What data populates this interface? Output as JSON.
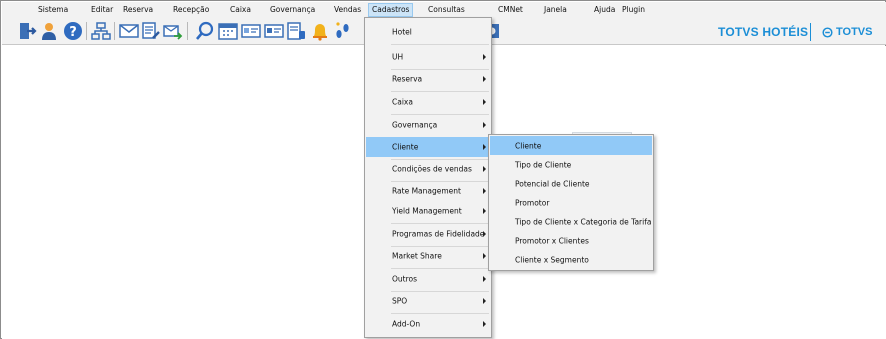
{
  "menubar": {
    "items": [
      "Sistema",
      "Editar",
      "Reserva",
      "Recepção",
      "Caixa",
      "Governança",
      "Vendas",
      "Cadastros",
      "Consultas",
      "CMNet",
      "Janela",
      "Ajuda",
      "Plugin"
    ],
    "active": "Cadastros"
  },
  "toolbar": {
    "icons": [
      "exit-icon",
      "user-icon",
      "help-icon",
      "network-icon",
      "mail-icon",
      "mail-edit-icon",
      "mail-send-icon",
      "search-icon",
      "calendar-icon",
      "card-icon",
      "card-alt-icon",
      "phone-icon",
      "bell-icon",
      "footprints-icon"
    ]
  },
  "brand": {
    "name": "TOTVS HOTÉIS",
    "logo": "TOTVS",
    "color": "#1b8ed6"
  },
  "cadastros_menu": {
    "items": [
      {
        "label": "Hotel",
        "submenu": false
      },
      {
        "label": "UH",
        "submenu": true
      },
      {
        "label": "Reserva",
        "submenu": true
      },
      {
        "label": "Caixa",
        "submenu": true
      },
      {
        "label": "Governança",
        "submenu": true
      },
      {
        "label": "Cliente",
        "submenu": true,
        "highlighted": true
      },
      {
        "label": "Condições de vendas",
        "submenu": true
      },
      {
        "label": "Rate Management",
        "submenu": true
      },
      {
        "label": "Yield Management",
        "submenu": true
      },
      {
        "label": "Programas de Fidelidade",
        "submenu": true
      },
      {
        "label": "Market Share",
        "submenu": true
      },
      {
        "label": "Outros",
        "submenu": true
      },
      {
        "label": "SPO",
        "submenu": true
      },
      {
        "label": "Add-On",
        "submenu": true
      }
    ]
  },
  "cliente_submenu": {
    "items": [
      {
        "label": "Cliente",
        "highlighted": true
      },
      {
        "label": "Tipo de Cliente"
      },
      {
        "label": "Potencial de Cliente"
      },
      {
        "label": "Promotor"
      },
      {
        "label": "Tipo de Cliente x Categoria de Tarifa"
      },
      {
        "label": "Promotor x Clientes"
      },
      {
        "label": "Cliente x Segmento"
      }
    ]
  },
  "colors": {
    "menu_highlight": "#91c9f7",
    "menubar_active": "#cce4f7",
    "menu_background": "#f2f2f2"
  }
}
